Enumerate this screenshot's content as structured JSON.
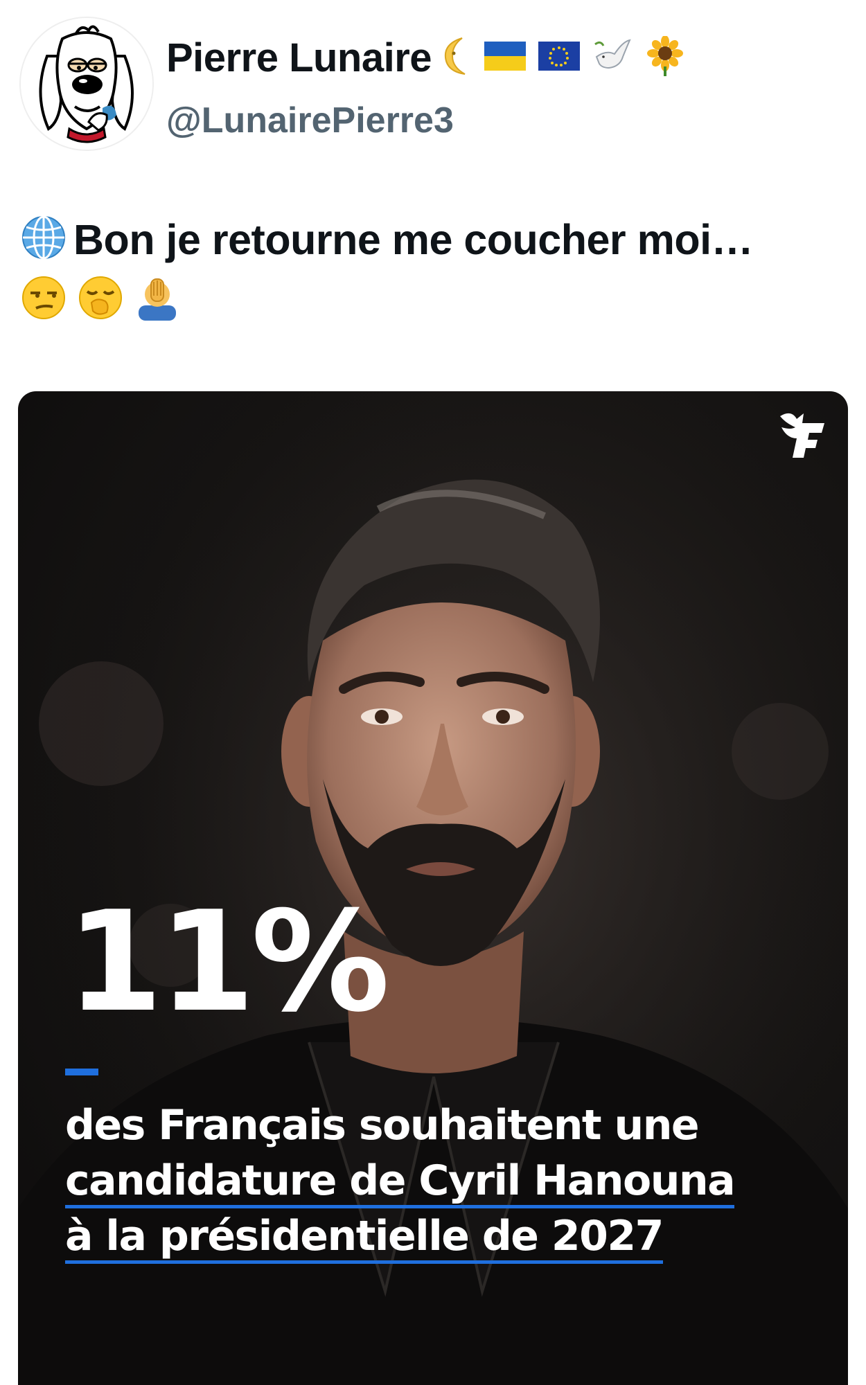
{
  "author": {
    "display_name": "Pierre Lunaire",
    "handle": "@LunairePierre3",
    "name_emojis": [
      "moon-face-icon",
      "ukraine-flag-icon",
      "eu-flag-icon",
      "dove-icon",
      "sunflower-icon"
    ]
  },
  "tweet": {
    "text": "Bon je retourne me coucher moi…",
    "leading_emoji": "globe-icon",
    "trailing_emojis": [
      "unamused-face-icon",
      "yawning-face-icon",
      "facepalm-icon"
    ]
  },
  "media": {
    "stat": "11%",
    "caption_lines": [
      "des Français souhaitent une",
      "candidature de Cyril Hanouna",
      "à la présidentielle de 2027"
    ],
    "logo_icon": "le-figaro-logo-icon",
    "accent_color": "#1f6fde"
  }
}
